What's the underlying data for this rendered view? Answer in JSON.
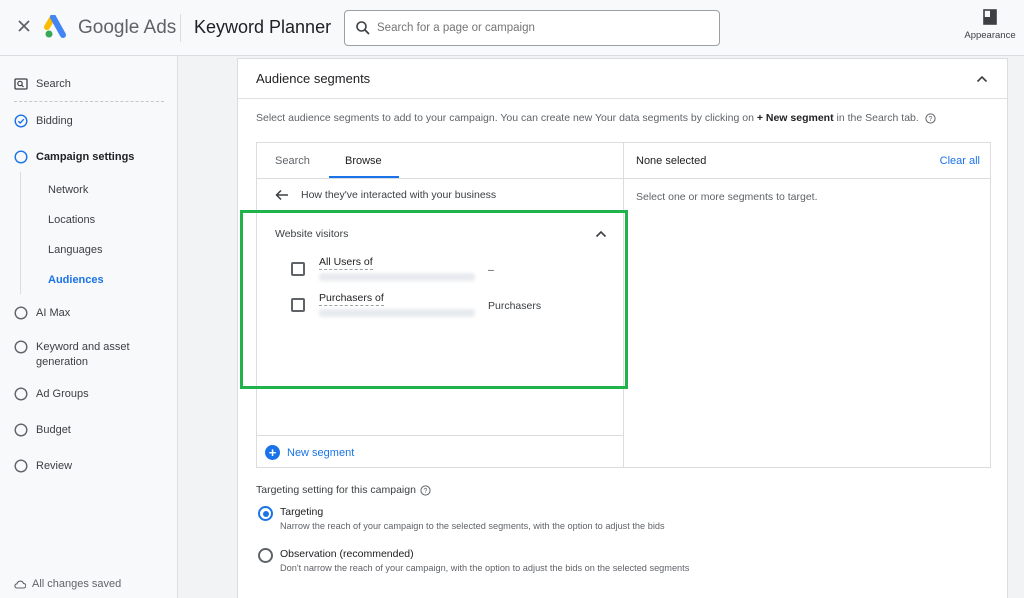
{
  "header": {
    "brand_prefix": "Google",
    "brand_suffix": "Ads",
    "tool_title": "Keyword Planner",
    "search_placeholder": "Search for a page or campaign",
    "appearance_label": "Appearance"
  },
  "sidebar": {
    "items": [
      {
        "label": "Search",
        "icon": "search-box-icon"
      },
      {
        "label": "Bidding",
        "icon": "check-circle-icon",
        "state": "done"
      },
      {
        "label": "Campaign settings",
        "icon": "circle-outline-icon",
        "state": "current"
      },
      {
        "label": "AI Max",
        "icon": "circle-outline-icon"
      },
      {
        "label": "Keyword and asset",
        "label_line2": "generation",
        "icon": "circle-outline-icon"
      },
      {
        "label": "Ad Groups",
        "icon": "circle-outline-icon"
      },
      {
        "label": "Budget",
        "icon": "circle-outline-icon"
      },
      {
        "label": "Review",
        "icon": "circle-outline-icon"
      }
    ],
    "subitems": [
      {
        "label": "Network"
      },
      {
        "label": "Locations"
      },
      {
        "label": "Languages"
      },
      {
        "label": "Audiences",
        "active": true
      }
    ],
    "status": "All changes saved"
  },
  "card": {
    "title": "Audience segments",
    "description_pre": "Select audience segments to add to your campaign. You can create new Your data segments by clicking on ",
    "description_bold": "+ New segment",
    "description_post": " in the Search tab.",
    "tabs": [
      "Search",
      "Browse"
    ],
    "active_tab": "Browse",
    "back_label": "How they've interacted with your business",
    "group_label": "Website visitors",
    "segments": [
      {
        "name": "All Users of",
        "type": "–"
      },
      {
        "name": "Purchasers of",
        "type": "Purchasers"
      }
    ],
    "new_segment_label": "New segment",
    "none_selected": "None selected",
    "clear_all": "Clear all",
    "right_hint": "Select one or more segments to target."
  },
  "targeting": {
    "heading": "Targeting setting for this campaign",
    "options": [
      {
        "label": "Targeting",
        "desc": "Narrow the reach of your campaign to the selected segments, with the option to adjust the bids",
        "selected": true
      },
      {
        "label": "Observation (recommended)",
        "desc": "Don't narrow the reach of your campaign, with the option to adjust the bids on the selected segments",
        "selected": false
      }
    ]
  },
  "colors": {
    "accent": "#1a73e8",
    "highlight": "#20b24b"
  }
}
